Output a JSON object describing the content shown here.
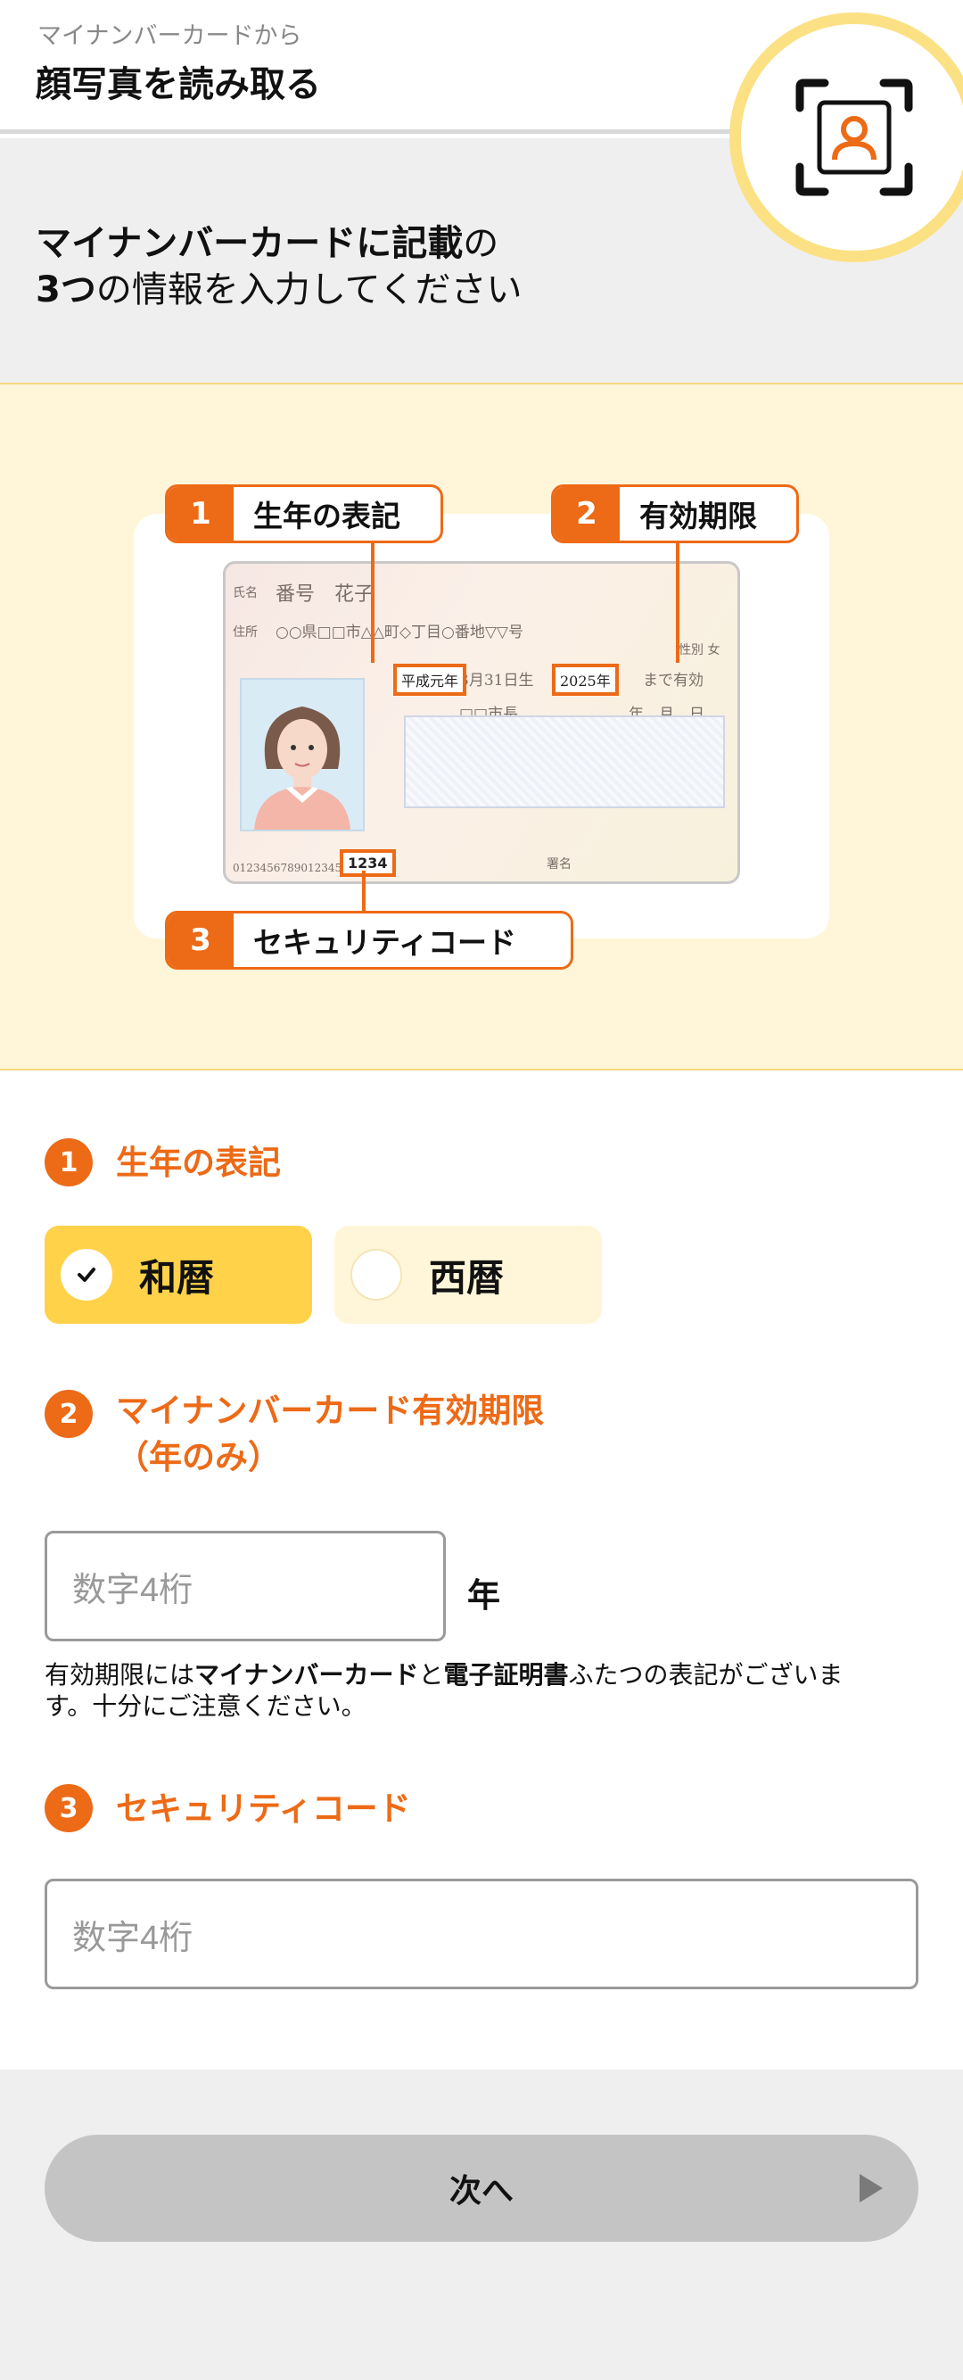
{
  "header": {
    "subtitle": "マイナンバーカードから",
    "title": "顔写真を読み取る",
    "badge_icon": "face-scan-icon"
  },
  "intro": {
    "line1_strong": "マイナンバーカードに記載",
    "line1_rest": "の",
    "line2_strong": "3つ",
    "line2_rest": "の情報を入力してください"
  },
  "illustration": {
    "callouts": [
      {
        "num": "1",
        "label": "生年の表記"
      },
      {
        "num": "2",
        "label": "有効期限"
      },
      {
        "num": "3",
        "label": "セキュリティコード"
      }
    ],
    "card": {
      "name_label": "氏名",
      "name_value": "番号　花子",
      "address_label": "住所",
      "address_value": "○○県□□市△△町◇丁目○番地▽▽号",
      "birth_era": "平成元年",
      "birth_rest": "3月31日生",
      "expiry_year": "2025年",
      "expiry_rest": "まで有効",
      "gender": "性別 女",
      "mayor": "□□市長",
      "ymd": "年　月　日",
      "card_no": "0123456789012345​6",
      "security_code": "1234",
      "sign": "署名"
    }
  },
  "form": {
    "section1": {
      "num": "1",
      "label": "生年の表記"
    },
    "radio_options": [
      {
        "label": "和暦",
        "selected": true
      },
      {
        "label": "西暦",
        "selected": false
      }
    ],
    "section2": {
      "num": "2",
      "label": "マイナンバーカード有効期限",
      "label2": "（年のみ）"
    },
    "expiry_placeholder": "数字4桁",
    "expiry_unit": "年",
    "note": {
      "p1": "有効期限には",
      "b1": "マイナンバーカード",
      "p2": "と",
      "b2": "電子証明書",
      "p3": "ふたつの表記がございます。十分にご注意ください。"
    },
    "section3": {
      "num": "3",
      "label": "セキュリティコード"
    },
    "security_placeholder": "数字4桁"
  },
  "footer": {
    "next_label": "次へ"
  },
  "colors": {
    "accent": "#ed6a16",
    "selected": "#ffd24a",
    "badge_ring": "#fbe183",
    "illustration_bg": "#fff6da"
  }
}
